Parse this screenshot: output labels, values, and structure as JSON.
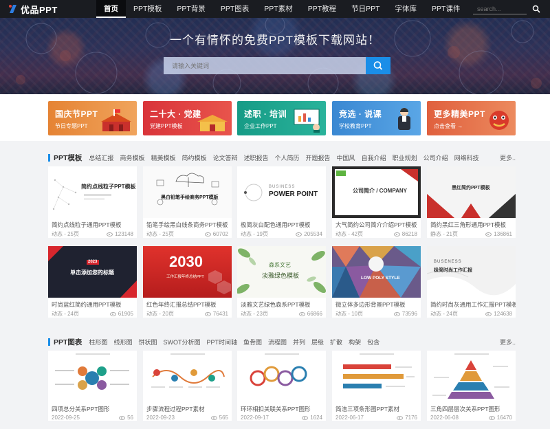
{
  "nav": {
    "logo_text": "优品PPT",
    "links": [
      "首页",
      "PPT模板",
      "PPT背景",
      "PPT图表",
      "PPT素材",
      "PPT教程",
      "节日PPT",
      "字体库",
      "PPT课件"
    ],
    "search_placeholder": "search..."
  },
  "hero": {
    "title": "一个有情怀的免费PPT模板下载网站！",
    "search_placeholder": "请输入关键词"
  },
  "categories": [
    {
      "title": "国庆节PPT",
      "subtitle": "节日专题PPT",
      "color": "#e8873a"
    },
    {
      "title": "二十大 · 党建",
      "subtitle": "党建PPT模板",
      "color": "#d23a3a"
    },
    {
      "title": "述职 · 培训",
      "subtitle": "企业工作PPT",
      "color": "#1e9e8a"
    },
    {
      "title": "竞选 · 说课",
      "subtitle": "学校教育PPT",
      "color": "#3d8fd6"
    },
    {
      "title": "更多精美PPT",
      "subtitle": "点击查看 →",
      "color": "#e06a4a"
    }
  ],
  "templates_section": {
    "title": "PPT模板",
    "tags": [
      "总结汇报",
      "商务模板",
      "精美模板",
      "简约模板",
      "论文答辩",
      "述职报告",
      "个人简历",
      "开题报告",
      "中国风",
      "自我介绍",
      "职业规划",
      "公司介绍",
      "网络科技"
    ],
    "more": "更多..",
    "cards": [
      {
        "title": "简约点线粒子通用PPT模板",
        "meta": "动态 - 25页",
        "views": "123148",
        "thumb_text": "简约点线粒子PPT模板"
      },
      {
        "title": "铅笔手绘黑白线条商务PPT模板",
        "meta": "动态 - 25页",
        "views": "60702",
        "thumb_text": "黑白铅笔手绘商务PPT模板"
      },
      {
        "title": "极简灰白配色通用PPT模板",
        "meta": "动态 - 19页",
        "views": "205534",
        "thumb_text": "POWER POINT",
        "thumb_sub": "BUSINESS"
      },
      {
        "title": "大气简约公司简介介绍PPT模板",
        "meta": "动态 - 42页",
        "views": "86218",
        "thumb_text": "公司简介 / COMPANY"
      },
      {
        "title": "简约黑红三角形通用PPT模板",
        "meta": "静态 - 21页",
        "views": "136861",
        "thumb_text": "黑红简约PPT模板"
      },
      {
        "title": "时尚蓝红简约通用PPT模板",
        "meta": "动态 - 24页",
        "views": "61905",
        "thumb_text": "单击添加您的标题",
        "thumb_sub": "2023"
      },
      {
        "title": "红色年终汇报总结PPT模板",
        "meta": "动态 - 20页",
        "views": "76431",
        "thumb_text": "2030",
        "thumb_sub": "工作汇报年终总结PPT"
      },
      {
        "title": "淡雅文艺绿色森系PPT模板",
        "meta": "动态 - 23页",
        "views": "66866",
        "thumb_text": "淡雅绿色模板",
        "thumb_sub": "森系文艺"
      },
      {
        "title": "微立体多边形背景PPT模板",
        "meta": "动态 - 10页",
        "views": "73596",
        "thumb_text": "LOW POLY STYLE"
      },
      {
        "title": "简约时尚灰通用工作汇报PPT模板",
        "meta": "动态 - 24页",
        "views": "124638",
        "thumb_text": "极简时尚工作汇报",
        "thumb_sub": "BUSENESS"
      }
    ]
  },
  "charts_section": {
    "title": "PPT图表",
    "tags": [
      "柱形图",
      "线形图",
      "饼状图",
      "SWOT分析图",
      "PPT时间轴",
      "鱼骨图",
      "流程图",
      "并列",
      "层级",
      "扩散",
      "构架",
      "包含"
    ],
    "more": "更多..",
    "cards": [
      {
        "title": "四项总分关系PPT图形",
        "meta": "2022-09-25",
        "views": "56"
      },
      {
        "title": "步骤流程过程PPT素材",
        "meta": "2022-09-23",
        "views": "565"
      },
      {
        "title": "环环相扣关联关系PPT图形",
        "meta": "2022-09-17",
        "views": "1624"
      },
      {
        "title": "简洁三项条形图PPT素材",
        "meta": "2022-06-17",
        "views": "7176"
      },
      {
        "title": "三角四层层次关系PPT图形",
        "meta": "2022-06-08",
        "views": "16470"
      }
    ]
  }
}
